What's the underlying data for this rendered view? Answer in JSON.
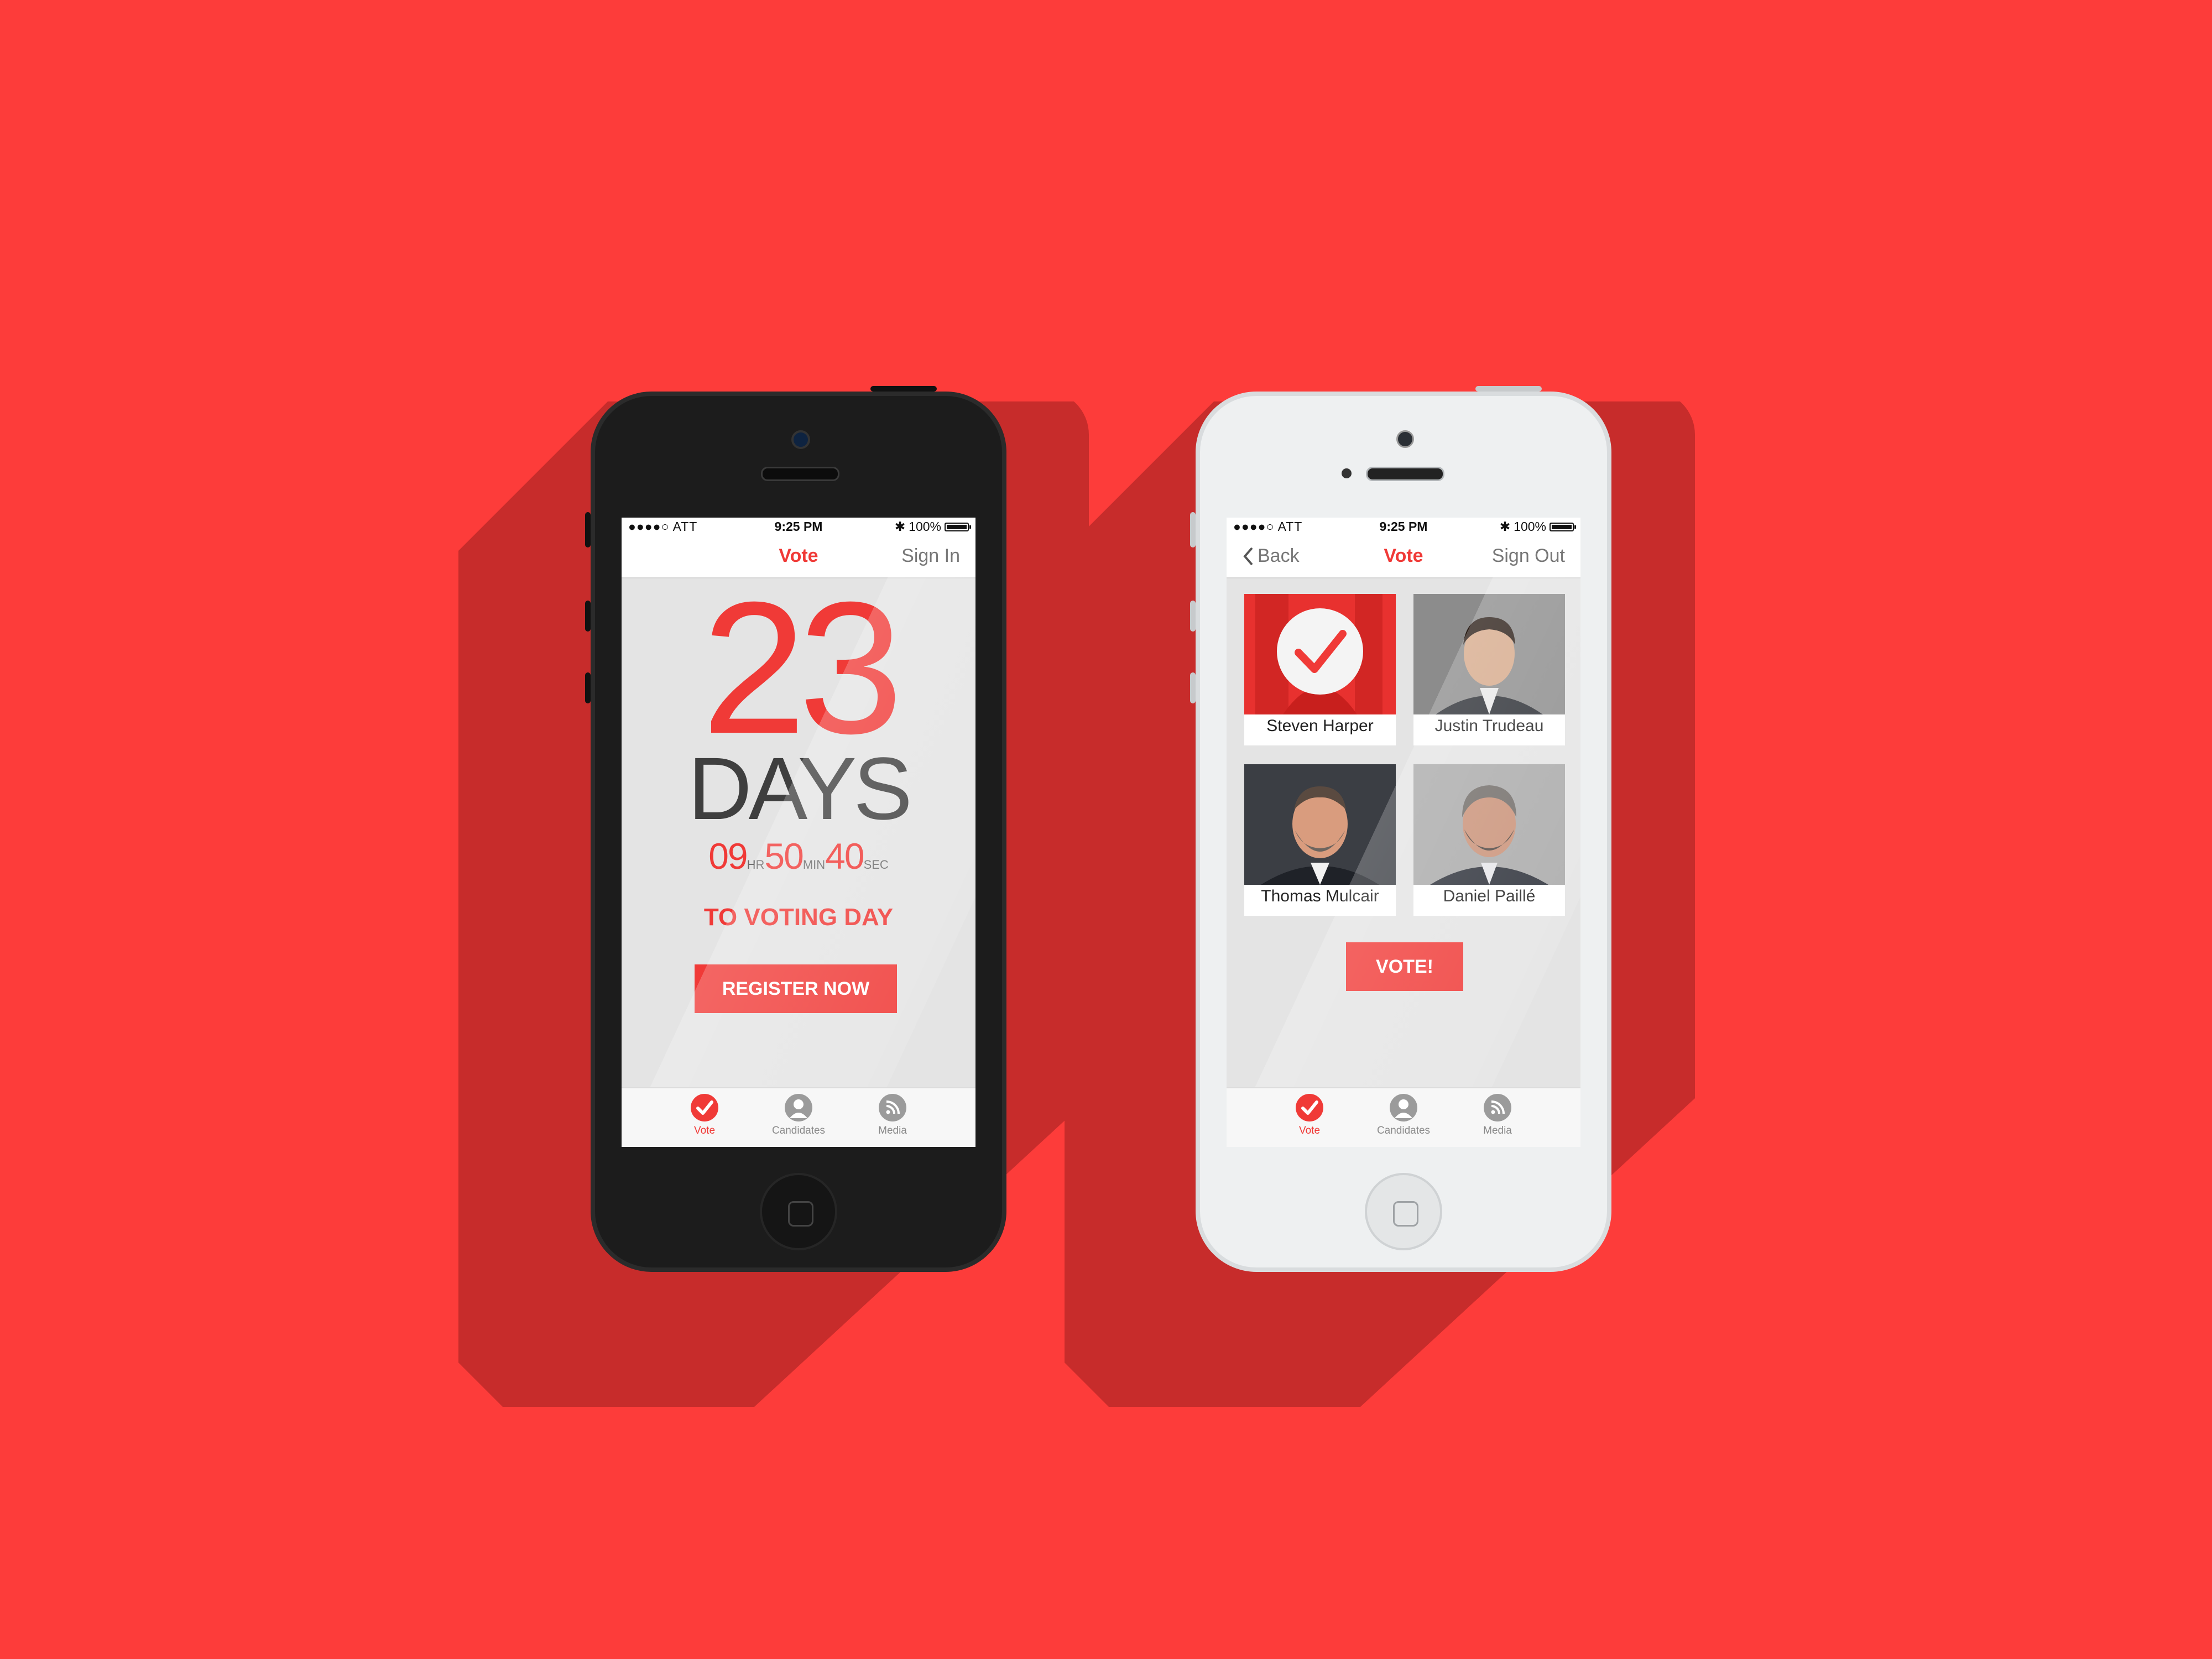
{
  "left_phone": {
    "status": {
      "carrier": "●●●●○ ATT",
      "time": "9:25 PM",
      "battery": "100%"
    },
    "nav": {
      "title": "Vote",
      "right": "Sign In"
    },
    "countdown": {
      "days_number": "23",
      "days_label": "DAYS",
      "hours": "09",
      "hours_unit": "HR",
      "minutes": "50",
      "minutes_unit": "MIN",
      "seconds": "40",
      "seconds_unit": "SEC",
      "caption": "TO VOTING DAY"
    },
    "register_button": "REGISTER NOW",
    "tabs": [
      "Vote",
      "Candidates",
      "Media"
    ]
  },
  "right_phone": {
    "status": {
      "carrier": "●●●●○ ATT",
      "time": "9:25 PM",
      "battery": "100%"
    },
    "nav": {
      "back": "Back",
      "title": "Vote",
      "right": "Sign Out"
    },
    "candidates": [
      "Steven Harper",
      "Justin Trudeau",
      "Thomas Mulcair",
      "Daniel Paillé"
    ],
    "vote_button": "VOTE!",
    "tabs": [
      "Vote",
      "Candidates",
      "Media"
    ]
  },
  "colors": {
    "background": "#fd3c3a",
    "accent": "#f03a37"
  }
}
